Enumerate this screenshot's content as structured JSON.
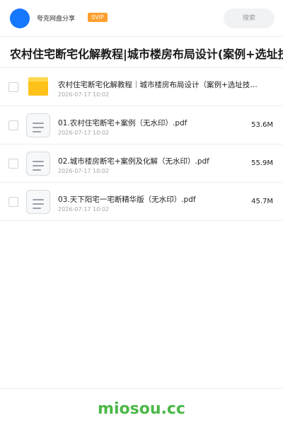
{
  "header": {
    "app_name": "夸克网盘分享",
    "badge": "SVIP",
    "search_placeholder": "搜索"
  },
  "folder": {
    "title": "农村住宅断宅化解教程|城市楼房布局设计(案例+选址技巧+"
  },
  "files": [
    {
      "type": "folder",
      "name": "农村住宅断宅化解教程｜城市楼房布局设计（案例+选址技巧+",
      "date": "2026-07-17 10:02",
      "size": ""
    },
    {
      "type": "doc",
      "name": "01.农村住宅断宅+案例（无水印）.pdf",
      "date": "2026-07-17 10:02",
      "size": "53.6M"
    },
    {
      "type": "doc",
      "name": "02.城市楼房断宅+案例及化解（无水印）.pdf",
      "date": "2026-07-17 10:02",
      "size": "55.9M"
    },
    {
      "type": "doc",
      "name": "03.天下阳宅一宅断精华版（无水印）.pdf",
      "date": "2026-07-17 10:02",
      "size": "45.7M"
    }
  ],
  "footer": {
    "brand": "miosou.cc"
  },
  "colors": {
    "accent_blue": "#1677ff",
    "svip_orange": "#ff9f2e",
    "brand_green": "#4cb848",
    "folder_yellow": "#ffc21a"
  }
}
